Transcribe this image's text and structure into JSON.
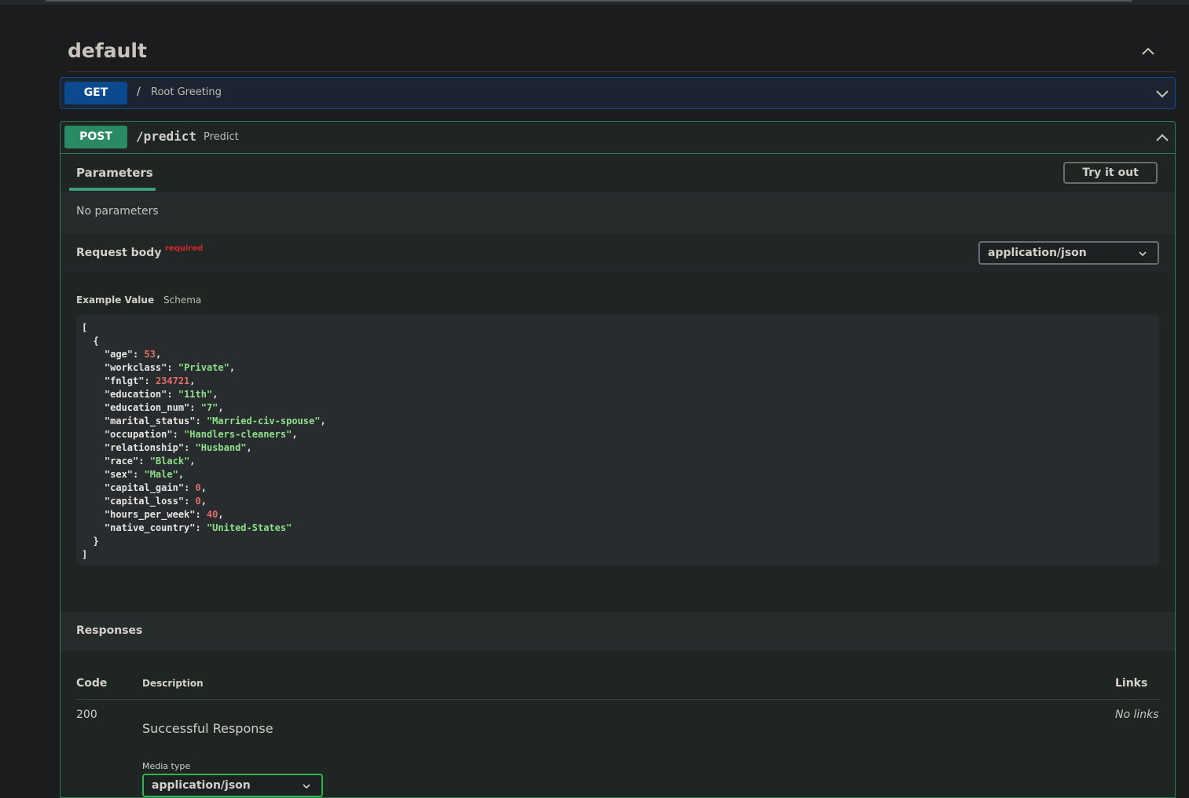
{
  "section": {
    "title": "default"
  },
  "get_op": {
    "method": "GET",
    "path": "/",
    "summary": "Root Greeting"
  },
  "post_op": {
    "method": "POST",
    "path": "/predict",
    "summary": "Predict",
    "params_tab": "Parameters",
    "try_label": "Try it out",
    "no_params": "No parameters",
    "request_body_label": "Request body",
    "required_label": "required",
    "content_type": "application/json",
    "example_label": "Example Value",
    "schema_label": "Schema",
    "example": [
      {
        "key": "age",
        "value": "53",
        "type": "number"
      },
      {
        "key": "workclass",
        "value": "\"Private\"",
        "type": "string"
      },
      {
        "key": "fnlgt",
        "value": "234721",
        "type": "number"
      },
      {
        "key": "education",
        "value": "\"11th\"",
        "type": "string"
      },
      {
        "key": "education_num",
        "value": "\"7\"",
        "type": "string"
      },
      {
        "key": "marital_status",
        "value": "\"Married-civ-spouse\"",
        "type": "string"
      },
      {
        "key": "occupation",
        "value": "\"Handlers-cleaners\"",
        "type": "string"
      },
      {
        "key": "relationship",
        "value": "\"Husband\"",
        "type": "string"
      },
      {
        "key": "race",
        "value": "\"Black\"",
        "type": "string"
      },
      {
        "key": "sex",
        "value": "\"Male\"",
        "type": "string"
      },
      {
        "key": "capital_gain",
        "value": "0",
        "type": "number"
      },
      {
        "key": "capital_loss",
        "value": "0",
        "type": "number"
      },
      {
        "key": "hours_per_week",
        "value": "40",
        "type": "number"
      },
      {
        "key": "native_country",
        "value": "\"United-States\"",
        "type": "string"
      }
    ]
  },
  "responses": {
    "title": "Responses",
    "columns": {
      "code": "Code",
      "description": "Description",
      "links": "Links"
    },
    "rows": [
      {
        "code": "200",
        "description": "Successful Response",
        "links": "No links",
        "media_type_label": "Media type",
        "media_type": "application/json"
      }
    ]
  },
  "colors": {
    "get": "#0c4a90",
    "post": "#2a8a63",
    "number": "#e06f6a",
    "string": "#8fe08a",
    "required": "#d9262a"
  }
}
